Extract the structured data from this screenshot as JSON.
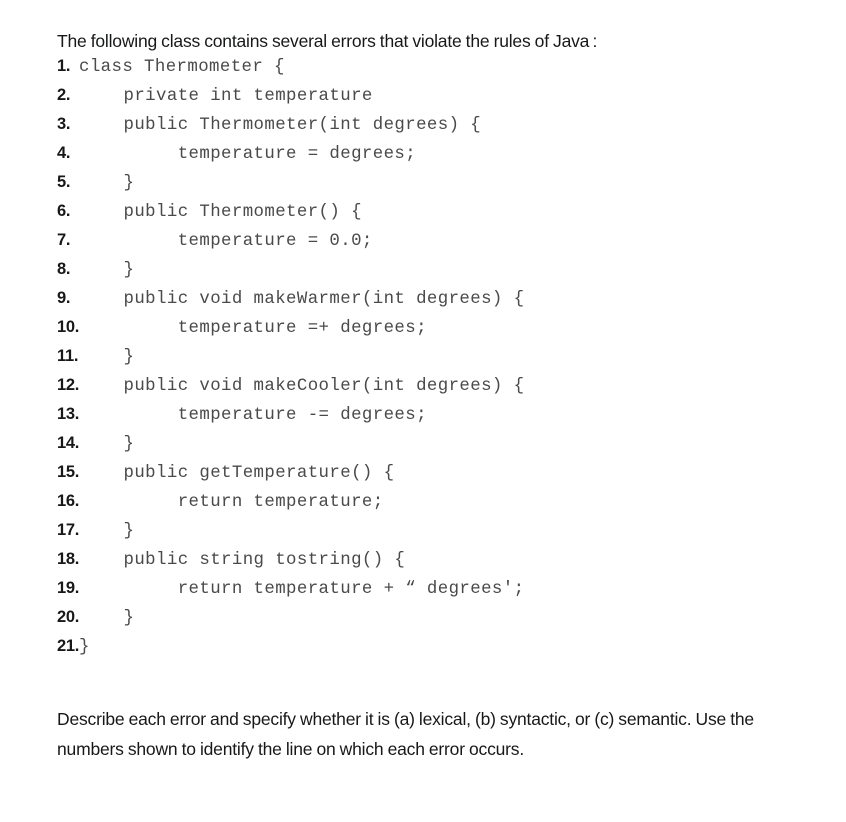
{
  "intro": {
    "text": "The following class contains several errors that violate the rules of Java :"
  },
  "listing": {
    "lines": [
      {
        "num": "1.",
        "code": "class Thermometer {",
        "tight": true
      },
      {
        "num": "2.",
        "code": "   private int temperature",
        "tight": false
      },
      {
        "num": "3.",
        "code": "   public Thermometer(int degrees) {",
        "tight": false
      },
      {
        "num": "4.",
        "code": "        temperature = degrees;",
        "tight": false
      },
      {
        "num": "5.",
        "code": "   }",
        "tight": false
      },
      {
        "num": "6.",
        "code": "   public Thermometer() {",
        "tight": false
      },
      {
        "num": "7.",
        "code": "        temperature = 0.0;",
        "tight": false
      },
      {
        "num": "8.",
        "code": "   }",
        "tight": false
      },
      {
        "num": "9.",
        "code": "   public void makeWarmer(int degrees) {",
        "tight": false
      },
      {
        "num": "10.",
        "code": "        temperature =+ degrees;",
        "tight": false
      },
      {
        "num": "11.",
        "code": "   }",
        "tight": false
      },
      {
        "num": "12.",
        "code": "   public void makeCooler(int degrees) {",
        "tight": false
      },
      {
        "num": "13.",
        "code": "        temperature -= degrees;",
        "tight": false
      },
      {
        "num": "14.",
        "code": "   }",
        "tight": false
      },
      {
        "num": "15.",
        "code": "   public getTemperature() {",
        "tight": false
      },
      {
        "num": "16.",
        "code": "        return temperature;",
        "tight": false
      },
      {
        "num": "17.",
        "code": "   }",
        "tight": false
      },
      {
        "num": "18.",
        "code": "   public string tostring() {",
        "tight": false
      },
      {
        "num": "19.",
        "code": "        return temperature + “ degrees';",
        "tight": false
      },
      {
        "num": "20.",
        "code": "   }",
        "tight": false
      },
      {
        "num": "21.",
        "code": "}",
        "tight": true
      }
    ]
  },
  "question": {
    "text": "Describe each error and specify whether it is (a) lexical, (b) syntactic, or (c) semantic. Use the numbers shown to identify the line on which each error occurs."
  }
}
